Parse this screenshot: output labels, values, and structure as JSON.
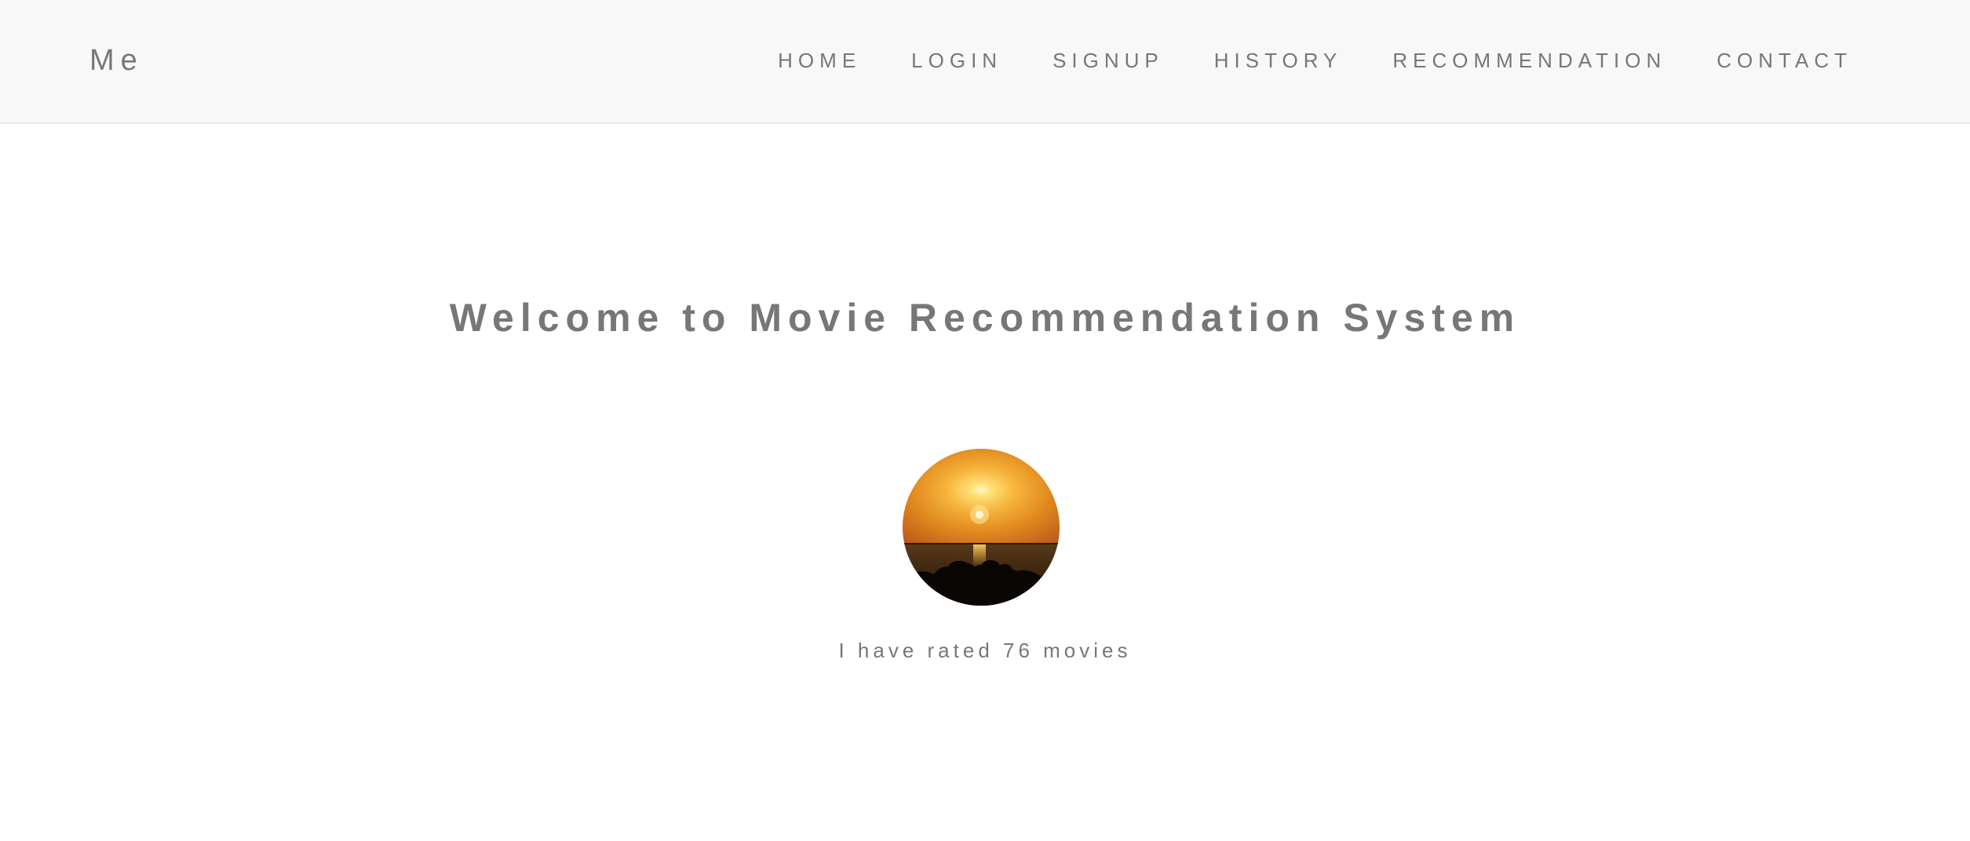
{
  "navbar": {
    "brand": "Me",
    "items": [
      {
        "label": "HOME"
      },
      {
        "label": "LOGIN"
      },
      {
        "label": "SIGNUP"
      },
      {
        "label": "HISTORY"
      },
      {
        "label": "RECOMMENDATION"
      },
      {
        "label": "CONTACT"
      }
    ]
  },
  "main": {
    "title": "Welcome to Movie Recommendation System",
    "avatar_icon": "sunset-avatar-icon",
    "rated_text": "I have rated 76 movies"
  },
  "colors": {
    "navbar_bg": "#f8f8f8",
    "text": "#777777",
    "page_bg": "#ffffff"
  }
}
